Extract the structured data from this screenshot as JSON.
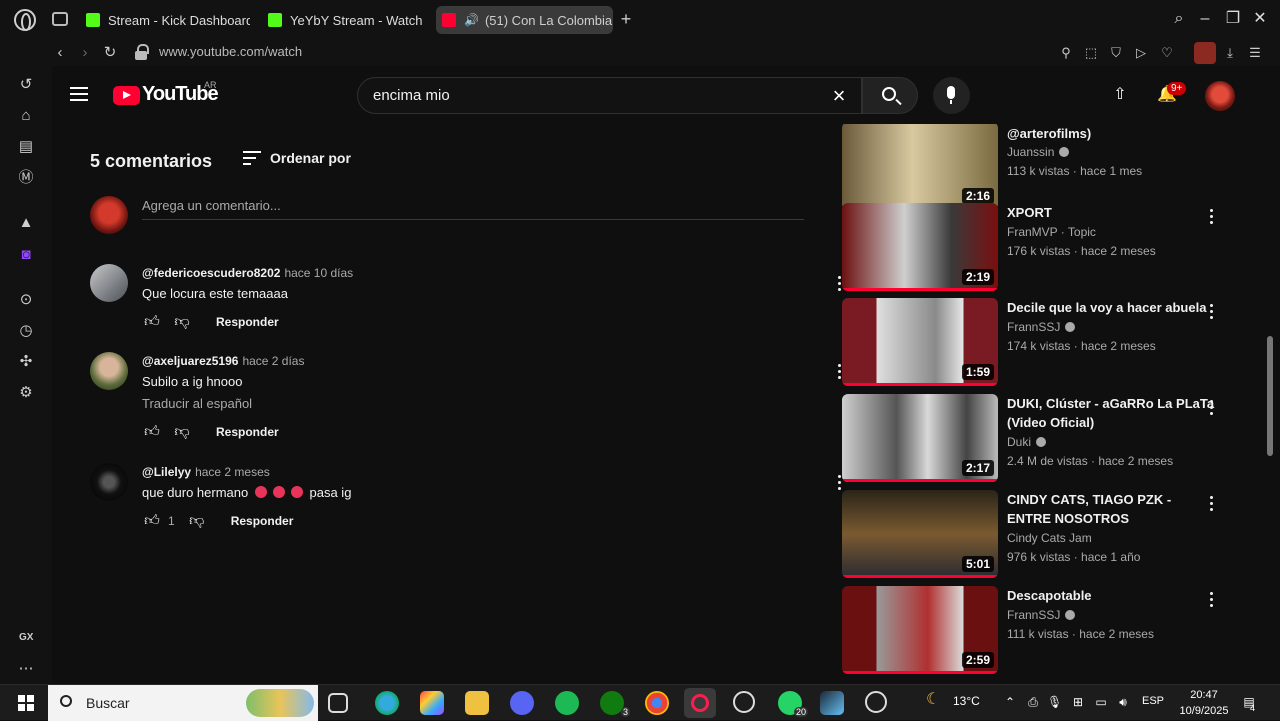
{
  "browser": {
    "tabs": [
      {
        "label": "Stream - Kick Dashboard",
        "icon": "kick-icon"
      },
      {
        "label": "YeYbY Stream - Watch Li",
        "icon": "kick-icon"
      },
      {
        "label": "(51) Con La Colombia",
        "icon": "youtube-icon",
        "active": true
      }
    ],
    "url": "www.youtube.com/watch"
  },
  "youtube": {
    "logo_text": "YouTube",
    "country": "AR",
    "search_value": "encima mio",
    "notification_count": "9+"
  },
  "comments": {
    "count_label": "5 comentarios",
    "sort_label": "Ordenar por",
    "add_placeholder": "Agrega un comentario...",
    "reply_label": "Responder",
    "items": [
      {
        "author": "@federicoescudero8202",
        "time": "hace 10 días",
        "text": "Que locura este temaaaa",
        "likes": "",
        "translate": ""
      },
      {
        "author": "@axeljuarez5196",
        "time": "hace 2 días",
        "text": "Subilo a ig hnooo",
        "likes": "",
        "translate": "Traducir al español"
      },
      {
        "author": "@Lilelyy",
        "time": "hace 2 meses",
        "text_before": "que duro hermano",
        "text_after": "pasa ig",
        "likes": "1",
        "translate": ""
      }
    ]
  },
  "related": [
    {
      "title": "@arterofilms)",
      "channel": "Juanssin",
      "verified": true,
      "stats": "113 k vistas · hace 1 mes",
      "duration": "2:16"
    },
    {
      "title": "XPORT",
      "channel": "FranMVP · Topic",
      "verified": false,
      "stats": "176 k vistas · hace 2 meses",
      "duration": "2:19"
    },
    {
      "title": "Decile que la voy a hacer abuela",
      "channel": "FrannSSJ",
      "verified": true,
      "stats": "174 k vistas · hace 2 meses",
      "duration": "1:59"
    },
    {
      "title": "DUKI, Clúster - aGaRRo La PLaTa (Video Oficial)",
      "channel": "Duki",
      "verified": true,
      "stats": "2.4 M de vistas · hace 2 meses",
      "duration": "2:17"
    },
    {
      "title": "CINDY CATS, TIAGO PZK - ENTRE NOSOTROS",
      "channel": "Cindy Cats Jam",
      "verified": false,
      "stats": "976 k vistas · hace 1 año",
      "duration": "5:01"
    },
    {
      "title": "Descapotable",
      "channel": "FrannSSJ",
      "verified": true,
      "stats": "111 k vistas · hace 2 meses",
      "duration": "2:59"
    }
  ],
  "taskbar": {
    "search_label": "Buscar",
    "whatsapp_badge": "20",
    "xbox_badge": "3",
    "weather": "13°C",
    "language": "ESP",
    "time": "20:47",
    "date": "10/9/2025",
    "notif_count": "4"
  }
}
